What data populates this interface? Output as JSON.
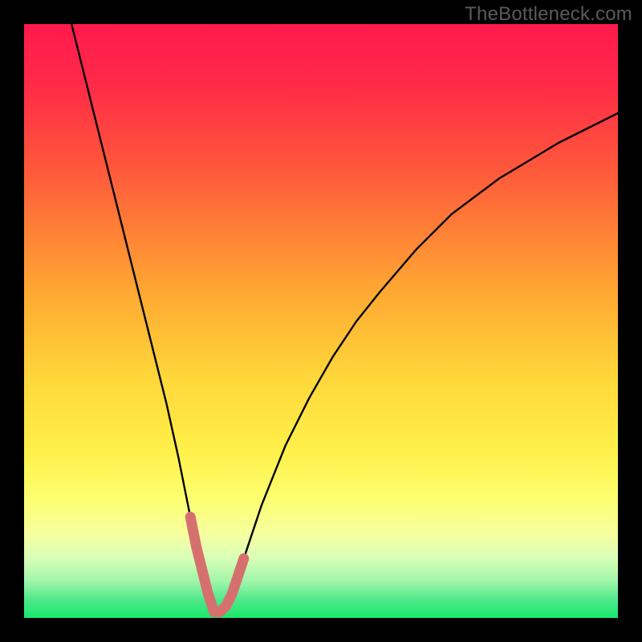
{
  "watermark": "TheBottleneck.com",
  "colors": {
    "frame": "#000000",
    "gradient_stops": [
      {
        "offset": 0.0,
        "color": "#ff1a4d"
      },
      {
        "offset": 0.1,
        "color": "#ff2a48"
      },
      {
        "offset": 0.25,
        "color": "#ff5a3a"
      },
      {
        "offset": 0.45,
        "color": "#ffa832"
      },
      {
        "offset": 0.6,
        "color": "#ffd83a"
      },
      {
        "offset": 0.72,
        "color": "#fff04a"
      },
      {
        "offset": 0.8,
        "color": "#fcff70"
      },
      {
        "offset": 0.86,
        "color": "#f6ffa0"
      },
      {
        "offset": 0.9,
        "color": "#d8ffb8"
      },
      {
        "offset": 0.94,
        "color": "#9cf5a8"
      },
      {
        "offset": 0.97,
        "color": "#4de88a"
      },
      {
        "offset": 1.0,
        "color": "#18e86a"
      }
    ],
    "curve_stroke": "#000000",
    "highlight_stroke": "#d6706f"
  },
  "chart_data": {
    "type": "line",
    "title": "",
    "xlabel": "",
    "ylabel": "",
    "xlim": [
      0,
      100
    ],
    "ylim": [
      0,
      100
    ],
    "note": "Axes implicit (no ticks or labels shown). x ≈ normalized hardware balance (0–100), y ≈ bottleneck percentage (0–100). Curve has a sharp minimum ~x=32 reaching y≈0; pink highlighted segment marks the near-optimal region around the trough.",
    "series": [
      {
        "name": "bottleneck-curve",
        "x": [
          8,
          10,
          12,
          14,
          16,
          18,
          20,
          22,
          24,
          26,
          27,
          28,
          29,
          30,
          31,
          32,
          33,
          34,
          35,
          36,
          37,
          38,
          40,
          44,
          48,
          52,
          56,
          60,
          66,
          72,
          80,
          90,
          100
        ],
        "y": [
          100,
          92,
          84,
          76,
          68,
          60,
          52,
          44,
          36,
          27,
          22,
          17,
          12,
          8,
          4,
          1,
          1,
          2,
          4,
          7,
          10,
          13,
          19,
          29,
          37,
          44,
          50,
          55,
          62,
          68,
          74,
          80,
          85
        ]
      },
      {
        "name": "optimal-region-highlight",
        "x": [
          28,
          29,
          30,
          31,
          32,
          33,
          34,
          35,
          36,
          37
        ],
        "y": [
          17,
          12,
          8,
          4,
          1,
          1,
          2,
          4,
          7,
          10
        ]
      }
    ]
  }
}
